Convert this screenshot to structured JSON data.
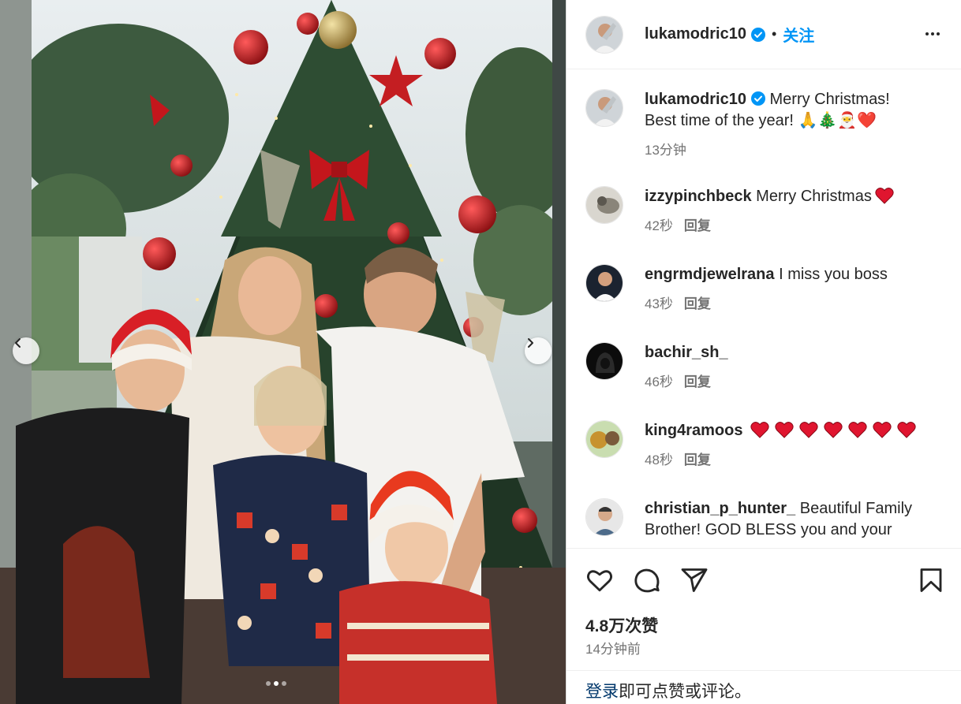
{
  "post": {
    "username": "lukamodric10",
    "follow_label": "关注",
    "separator": "•",
    "caption_line1": "Merry Christmas!",
    "caption_line2": "Best time of the year! 🙏🎄🎅❤️",
    "caption_time": "13分钟",
    "likes": "4.8万次赞",
    "posted_time": "14分钟前",
    "carousel": {
      "count": 3,
      "active_index": 1
    }
  },
  "comments": [
    {
      "user": "izzypinchbeck",
      "text": "Merry Christmas",
      "hearts": 1,
      "time": "42秒",
      "reply": "回复"
    },
    {
      "user": "engrmdjewelrana",
      "text": "I miss you boss",
      "hearts": 0,
      "time": "43秒",
      "reply": "回复"
    },
    {
      "user": "bachir_sh_",
      "text": "",
      "hearts": 0,
      "time": "46秒",
      "reply": "回复"
    },
    {
      "user": "king4ramoos",
      "text": "",
      "hearts": 7,
      "time": "48秒",
      "reply": "回复"
    },
    {
      "user": "christian_p_hunter_",
      "text": "Beautiful Family",
      "text_line2": "Brother! GOD BLESS you and your",
      "hearts": 0,
      "time": "",
      "reply": ""
    }
  ],
  "login": {
    "link": "登录",
    "rest": "即可点赞或评论。"
  },
  "colors": {
    "accent": "#0095f6",
    "heart": "#e0152f",
    "text": "#262626",
    "muted": "#737373"
  },
  "icons": [
    "verified-badge-icon",
    "more-options-icon",
    "heart-icon",
    "comment-icon",
    "share-icon",
    "bookmark-icon",
    "chevron-left-icon",
    "chevron-right-icon"
  ]
}
